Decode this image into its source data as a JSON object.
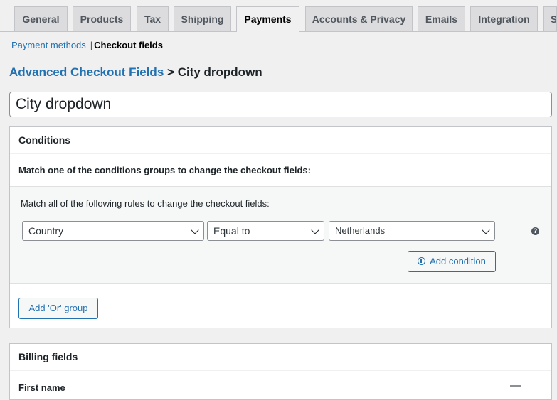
{
  "tabs": [
    {
      "label": "General"
    },
    {
      "label": "Products"
    },
    {
      "label": "Tax"
    },
    {
      "label": "Shipping"
    },
    {
      "label": "Payments"
    },
    {
      "label": "Accounts & Privacy"
    },
    {
      "label": "Emails"
    },
    {
      "label": "Integration"
    },
    {
      "label": "S"
    }
  ],
  "active_tab": "Payments",
  "subnav": {
    "payment_methods": "Payment methods",
    "separator": "|",
    "checkout_fields": "Checkout fields"
  },
  "breadcrumb": {
    "link": "Advanced Checkout Fields",
    "separator": ">",
    "current": "City dropdown"
  },
  "title_input": {
    "value": "City dropdown"
  },
  "conditions": {
    "heading": "Conditions",
    "intro": "Match one of the conditions groups to change the checkout fields:",
    "group_intro": "Match all of the following rules to change the checkout fields:",
    "rule": {
      "field": "Country",
      "operator": "Equal to",
      "value": "Netherlands"
    },
    "add_condition_label": "Add condition",
    "add_or_group_label": "Add 'Or' group",
    "help_icon": "?"
  },
  "billing": {
    "heading": "Billing fields",
    "first_field_label": "First name"
  },
  "colors": {
    "link": "#2271b1",
    "background": "#f0f0f1",
    "panel": "#ffffff"
  }
}
